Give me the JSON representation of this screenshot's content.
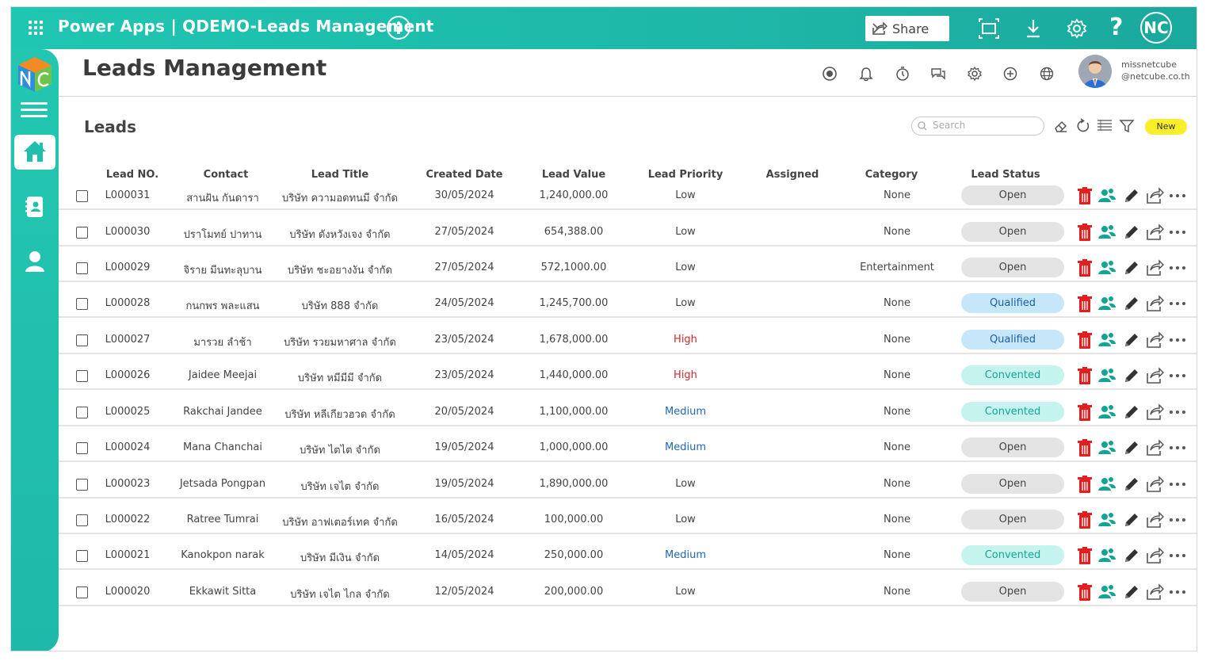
{
  "topbar": {
    "app_title": "Power Apps | QDEMO-Leads Management",
    "share_label": "Share",
    "user_initials": "NC",
    "help_glyph": "?"
  },
  "header": {
    "title": "Leads Management",
    "username": "missnetcube",
    "user_domain": "@netcube.co.th"
  },
  "section": {
    "title": "Leads",
    "search_placeholder": "Search",
    "new_label": "New"
  },
  "table": {
    "columns": [
      "Lead NO.",
      "Contact",
      "Lead Title",
      "Created Date",
      "Lead Value",
      "Lead Priority",
      "Assigned",
      "Category",
      "Lead Status"
    ],
    "rows": [
      {
        "no": "L000031",
        "contact": "สานฝัน กันดารา",
        "title": "บริษัท ความอดทนมี จำกัด",
        "date": "30/05/2024",
        "value": "1,240,000.00",
        "priority": "Low",
        "assigned": "",
        "category": "None",
        "status": "Open"
      },
      {
        "no": "L000030",
        "contact": "ปราโมทย์ ปาทาน",
        "title": "บริษัท ดังหวังเจง จำกัด",
        "date": "27/05/2024",
        "value": "654,388.00",
        "priority": "Low",
        "assigned": "",
        "category": "None",
        "status": "Open"
      },
      {
        "no": "L000029",
        "contact": "จิราย มีนทะลุบาน",
        "title": "บริษัท ชะอยางงัน จำกัด",
        "date": "27/05/2024",
        "value": "572,1000.00",
        "priority": "Low",
        "assigned": "",
        "category": "Entertainment",
        "status": "Open"
      },
      {
        "no": "L000028",
        "contact": "กนกพร พละแสน",
        "title": "บริษัท 888 จำกัด",
        "date": "24/05/2024",
        "value": "1,245,700.00",
        "priority": "Low",
        "assigned": "",
        "category": "None",
        "status": "Qualified"
      },
      {
        "no": "L000027",
        "contact": "มารวย ลำช้า",
        "title": "บริษัท รวยมหาศาล จำกัด",
        "date": "23/05/2024",
        "value": "1,678,000.00",
        "priority": "High",
        "assigned": "",
        "category": "None",
        "status": "Qualified"
      },
      {
        "no": "L000026",
        "contact": "Jaidee Meejai",
        "title": "บริษัท หมีมีมี จำกัด",
        "date": "23/05/2024",
        "value": "1,440,000.00",
        "priority": "High",
        "assigned": "",
        "category": "None",
        "status": "Convented"
      },
      {
        "no": "L000025",
        "contact": "Rakchai Jandee",
        "title": "บริษัท หลีเกียวฮวด จำกัด",
        "date": "20/05/2024",
        "value": "1,100,000.00",
        "priority": "Medium",
        "assigned": "",
        "category": "None",
        "status": "Convented"
      },
      {
        "no": "L000024",
        "contact": "Mana Chanchai",
        "title": "บริษัท ไตไต จำกัด",
        "date": "19/05/2024",
        "value": "1,000,000.00",
        "priority": "Medium",
        "assigned": "",
        "category": "None",
        "status": "Open"
      },
      {
        "no": "L000023",
        "contact": "Jetsada Pongpan",
        "title": "บริษัท เจไต จำกัด",
        "date": "19/05/2024",
        "value": "1,890,000.00",
        "priority": "Low",
        "assigned": "",
        "category": "None",
        "status": "Open"
      },
      {
        "no": "L000022",
        "contact": "Ratree Tumrai",
        "title": "บริษัท อาฟเตอร์เทค จำกัด",
        "date": "16/05/2024",
        "value": "100,000.00",
        "priority": "Low",
        "assigned": "",
        "category": "None",
        "status": "Open"
      },
      {
        "no": "L000021",
        "contact": "Kanokpon narak",
        "title": "บริษัท มีเงิน จำกัด",
        "date": "14/05/2024",
        "value": "250,000.00",
        "priority": "Medium",
        "assigned": "",
        "category": "None",
        "status": "Convented"
      },
      {
        "no": "L000020",
        "contact": "Ekkawit Sitta",
        "title": "บริษัท เจไต ไกล จำกัด",
        "date": "12/05/2024",
        "value": "200,000.00",
        "priority": "Low",
        "assigned": "",
        "category": "None",
        "status": "Open"
      }
    ]
  },
  "icons": {
    "topbar": [
      "waffle-icon",
      "info-icon",
      "share-icon",
      "fit-screen-icon",
      "download-icon",
      "gear-icon",
      "help-icon"
    ],
    "header": [
      "camera-icon",
      "bell-icon",
      "timer-icon",
      "chat-icon",
      "settings-icon",
      "add-circle-icon",
      "globe-icon"
    ],
    "toolbar": [
      "eraser-icon",
      "refresh-icon",
      "list-icon",
      "filter-icon"
    ],
    "row_actions": [
      "delete-icon",
      "assign-users-icon",
      "edit-icon",
      "share-icon",
      "more-icon"
    ]
  },
  "colors": {
    "brand": "#1fc6b0",
    "delete": "#e02020",
    "assign": "#13a593",
    "new_button": "#f8ee2a",
    "status_open": "#e4e4e4",
    "status_qualified": "#c6e7fa",
    "status_convented": "#c5f4ef"
  }
}
